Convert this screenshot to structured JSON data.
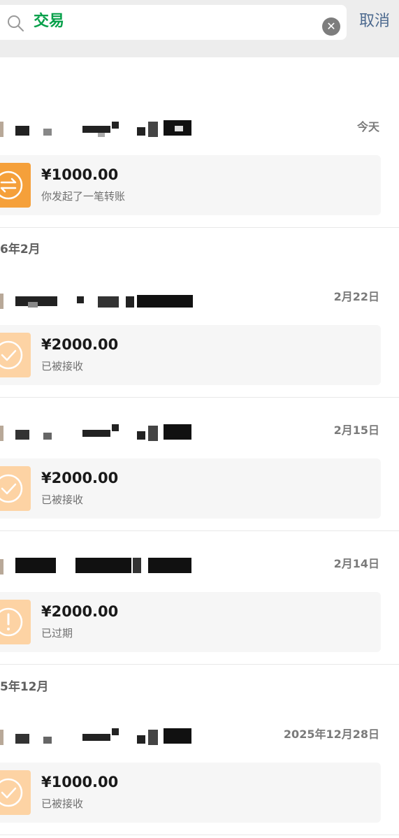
{
  "search": {
    "query": "交易",
    "cancel_label": "取消"
  },
  "months": {
    "m1": "6年2月",
    "m2": "5年12月"
  },
  "transactions": [
    {
      "date": "今天",
      "amount": "¥1000.00",
      "status": "你发起了一笔转账",
      "icon": "transfer-icon",
      "color": "#f5a03a"
    },
    {
      "date": "2月22日",
      "amount": "¥2000.00",
      "status": "已被接收",
      "icon": "check-icon",
      "color": "#fdd3a4"
    },
    {
      "date": "2月15日",
      "amount": "¥2000.00",
      "status": "已被接收",
      "icon": "check-icon",
      "color": "#fdd3a4"
    },
    {
      "date": "2月14日",
      "amount": "¥2000.00",
      "status": "已过期",
      "icon": "exclamation-icon",
      "color": "#fdd3a4"
    },
    {
      "date": "2025年12月28日",
      "amount": "¥1000.00",
      "status": "已被接收",
      "icon": "check-icon",
      "color": "#fdd3a4"
    }
  ]
}
